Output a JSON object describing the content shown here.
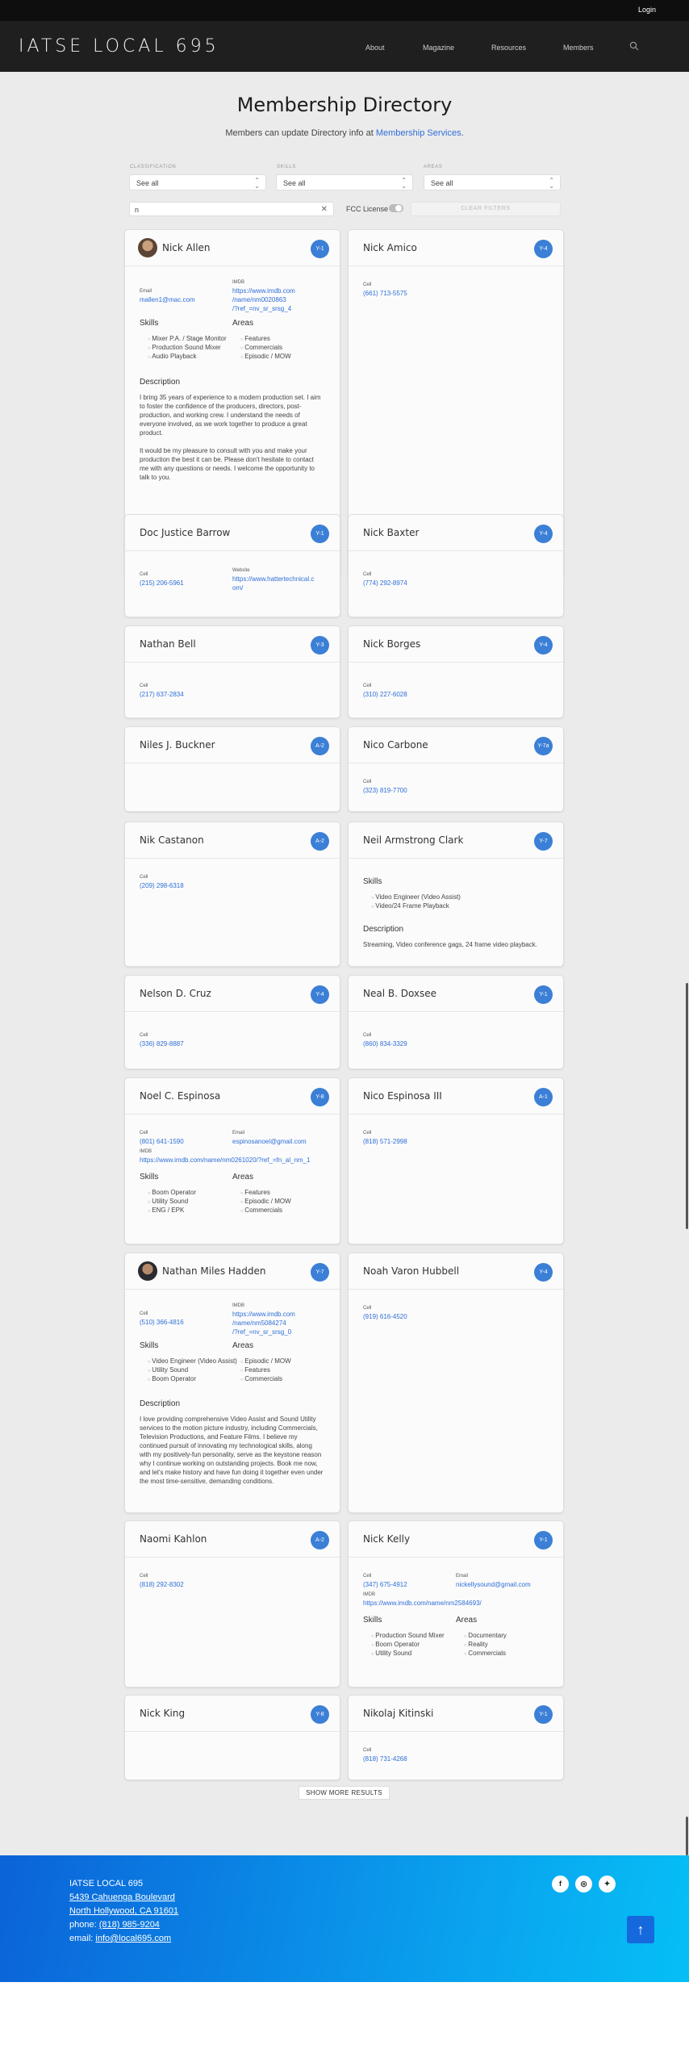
{
  "topbar": {
    "login": "Login"
  },
  "header": {
    "logo": "IATSE LOCAL 695",
    "nav": [
      "About",
      "Magazine",
      "Resources",
      "Members"
    ],
    "search_icon": "search-icon"
  },
  "page": {
    "title": "Membership Directory",
    "subtitle_prefix": "Members can update Directory info at ",
    "subtitle_link": "Membership Services",
    "subtitle_suffix": "."
  },
  "filters": {
    "classification_label": "CLASSIFICATION",
    "classification_value": "See all",
    "skills_label": "SKILLS",
    "skills_value": "See all",
    "areas_label": "AREAS",
    "areas_value": "See all",
    "name_value": "n",
    "clear_icon": "close-icon",
    "fcc_label": "FCC License",
    "fcc_on": false,
    "clear_filters": "CLEAR FILTERS"
  },
  "labels": {
    "email": "Email",
    "imdb": "IMDB",
    "cell": "Cell",
    "website": "Website",
    "skills": "Skills",
    "areas": "Areas",
    "description": "Description"
  },
  "members": [
    {
      "name": "Nick Allen",
      "badge": "Y-1",
      "email": "mallen1@mac.com",
      "imdb": [
        "https://www.imdb.com",
        "/name/nm0020863",
        "/?ref_=nv_sr_srsg_4"
      ],
      "skills": [
        "Mixer P.A. / Stage Monitor",
        "Production Sound Mixer",
        "Audio Playback"
      ],
      "areas": [
        "Features",
        "Commercials",
        "Episodic / MOW"
      ],
      "description": [
        "I bring 35 years of experience to a modern production set. I aim",
        "to foster the confidence of the producers, directors, post-",
        "production, and working crew. I understand the needs of",
        "everyone involved, as we work together to produce a great",
        "product.",
        "",
        "It would be my pleasure to consult with you and make your",
        "production the best it can be. Please don't hesitate to contact",
        "me with any questions or needs. I welcome the opportunity to",
        "talk to you."
      ]
    },
    {
      "name": "Nick Amico",
      "badge": "Y-4",
      "cell": "(661) 713-5575"
    },
    {
      "name": "Doc Justice Barrow",
      "badge": "Y-1",
      "cell": "(215) 206-5961",
      "website": [
        "https://www.hattertechnical.c",
        "om/"
      ]
    },
    {
      "name": "Nick Baxter",
      "badge": "Y-4",
      "cell": "(774) 292-8974"
    },
    {
      "name": "Nathan Bell",
      "badge": "Y-3",
      "cell": "(217) 637-2834"
    },
    {
      "name": "Nick Borges",
      "badge": "Y-4",
      "cell": "(310) 227-6028"
    },
    {
      "name": "Niles J. Buckner",
      "badge": "A-2"
    },
    {
      "name": "Nico Carbone",
      "badge": "Y-7a",
      "cell": "(323) 819-7700"
    },
    {
      "name": "Nik Castanon",
      "badge": "A-2",
      "cell": "(209) 298-6318"
    },
    {
      "name": "Neil Armstrong Clark",
      "badge": "Y-7",
      "skills": [
        "Video Engineer (Video Assist)",
        "Video/24 Frame Playback"
      ],
      "description": [
        "Streaming, Video conference gags, 24 frame video playback."
      ]
    },
    {
      "name": "Nelson D. Cruz",
      "badge": "Y-4",
      "cell": "(336) 829-8887"
    },
    {
      "name": "Neal B. Doxsee",
      "badge": "Y-1",
      "cell": "(860) 834-3329"
    },
    {
      "name": "Noel C. Espinosa",
      "badge": "Y-8",
      "cell": "(801) 641-1590",
      "email": "espinosanoel@gmail.com",
      "imdb": [
        "https://www.imdb.com/name/nm0261020/?ref_=fn_al_nm_1"
      ],
      "skills": [
        "Boom Operator",
        "Utility Sound",
        "ENG / EPK"
      ],
      "areas": [
        "Features",
        "Episodic / MOW",
        "Commercials"
      ]
    },
    {
      "name": "Nico Espinosa III",
      "badge": "A-1",
      "cell": "(818) 571-2998"
    },
    {
      "name": "Nathan Miles Hadden",
      "badge": "Y-7",
      "cell": "(510) 366-4816",
      "imdb": [
        "https://www.imdb.com",
        "/name/nm5084274",
        "/?ref_=nv_sr_srsg_0"
      ],
      "skills": [
        "Video Engineer (Video Assist)",
        "Utility Sound",
        "Boom Operator"
      ],
      "areas": [
        "Episodic / MOW",
        "Features",
        "Commercials"
      ],
      "description": [
        "I love providing comprehensive Video Assist and Sound Utility",
        "services to the motion picture industry, including Commercials,",
        "Television Productions, and Feature Films. I believe my",
        "continued pursuit of innovating my technological skills, along",
        "with my positively-fun personality, serve as the keystone reason",
        "why I continue working on outstanding projects. Book me now,",
        "and let's make history and have fun doing it together even under",
        "the most time-sensitive, demanding conditions."
      ]
    },
    {
      "name": "Noah Varon Hubbell",
      "badge": "Y-4",
      "cell": "(919) 616-4520"
    },
    {
      "name": "Naomi Kahlon",
      "badge": "A-2",
      "cell": "(818) 292-8302"
    },
    {
      "name": "Nick Kelly",
      "badge": "Y-1",
      "cell": "(347) 675-4912",
      "email": "nickellysound@gmail.com",
      "imdb": [
        "https://www.imdb.com/name/nm2584693/"
      ],
      "skills": [
        "Production Sound Mixer",
        "Boom Operator",
        "Utility Sound"
      ],
      "areas": [
        "Documentary",
        "Reality",
        "Commercials"
      ]
    },
    {
      "name": "Nick King",
      "badge": "Y-8"
    },
    {
      "name": "Nikolaj Kitinski",
      "badge": "Y-1",
      "cell": "(818) 731-4268"
    }
  ],
  "show_more": "SHOW MORE RESULTS",
  "footer": {
    "org": "IATSE LOCAL 695",
    "address1": "5439 Cahuenga Boulevard",
    "address2": "North Hollywood, CA 91601",
    "phone_label": "phone: ",
    "phone": "(818) 985-9204",
    "email_label": "email: ",
    "email": "info@local695.com",
    "social": [
      "facebook-icon",
      "instagram-icon",
      "twitter-icon"
    ],
    "to_top_icon": "arrow-up-icon"
  },
  "colors": {
    "accent": "#3b7fd6",
    "link": "#2e6fd8",
    "footer_start": "#0b63d8",
    "footer_end": "#06bff5",
    "header": "#1f1f1f"
  }
}
